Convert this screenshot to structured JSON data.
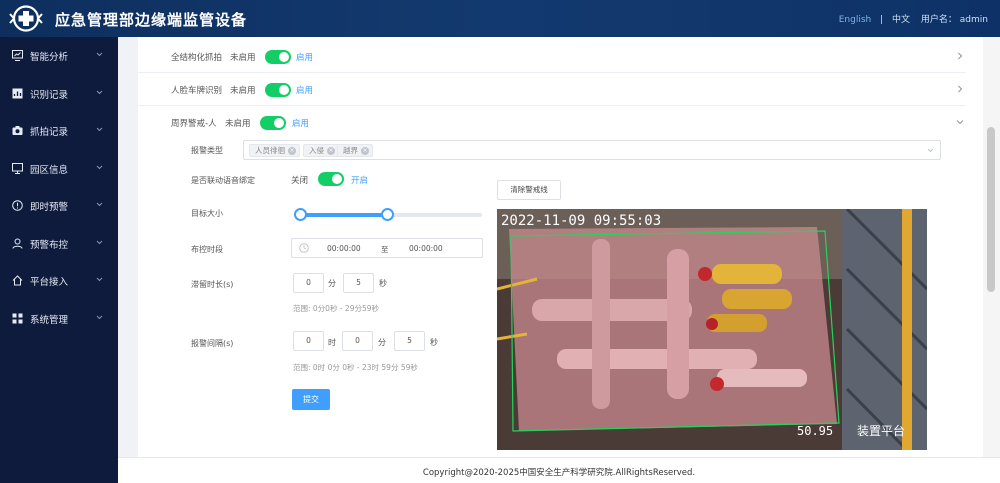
{
  "header": {
    "title": "应急管理部边缘端监管设备",
    "lang_en": "English",
    "lang_zh": "中文",
    "user_label": "用户名：",
    "username": "admin"
  },
  "sidebar": {
    "items": [
      {
        "label": "智能分析",
        "icon": "monitor-icon"
      },
      {
        "label": "识别记录",
        "icon": "chart-icon"
      },
      {
        "label": "抓拍记录",
        "icon": "camera-icon"
      },
      {
        "label": "园区信息",
        "icon": "screen-icon"
      },
      {
        "label": "即时预警",
        "icon": "alert-circle-icon"
      },
      {
        "label": "预警布控",
        "icon": "user-icon"
      },
      {
        "label": "平台接入",
        "icon": "home-icon"
      },
      {
        "label": "系统管理",
        "icon": "grid-icon"
      }
    ]
  },
  "rows": [
    {
      "label": "全结构化抓拍",
      "status": "未启用",
      "on_text": "启用"
    },
    {
      "label": "人脸车牌识别",
      "status": "未启用",
      "on_text": "启用"
    },
    {
      "label": "周界警戒-人",
      "status": "未启用",
      "on_text": "启用"
    }
  ],
  "form": {
    "alarm_type_label": "报警类型",
    "alarm_tags": [
      "人员徘徊",
      "入侵",
      "越界"
    ],
    "voice_link_label": "是否联动语音绑定",
    "voice_off": "关闭",
    "voice_on": "开启",
    "target_size_label": "目标大小",
    "slider_range": [
      0.0,
      0.48
    ],
    "schedule_label": "布控时段",
    "time_start": "00:00:00",
    "time_to": "至",
    "time_end": "00:00:00",
    "stay_label": "滞留时长(s)",
    "stay_min": "0",
    "stay_min_unit": "分",
    "stay_sec": "5",
    "stay_sec_unit": "秒",
    "stay_hint": "范围: 0分0秒 - 29分59秒",
    "interval_label": "报警间隔(s)",
    "interval_h": "0",
    "interval_h_unit": "时",
    "interval_m": "0",
    "interval_m_unit": "分",
    "interval_s": "5",
    "interval_s_unit": "秒",
    "interval_hint": "范围: 0时 0分 0秒 - 23时 59分 59秒",
    "submit": "提交",
    "clear_line": "清除警戒线"
  },
  "video": {
    "timestamp": "2022-11-09 09:55:03",
    "value": "50.95",
    "location": "装置平台"
  },
  "footer": {
    "copyright": "Copyright@2020-2025中国安全生产科学研究院.AllRightsReserved."
  },
  "colors": {
    "header_bg": "#0e2f5e",
    "sidebar_bg": "#0f1b3d",
    "switch_on": "#13ce66",
    "accent": "#409eff"
  }
}
